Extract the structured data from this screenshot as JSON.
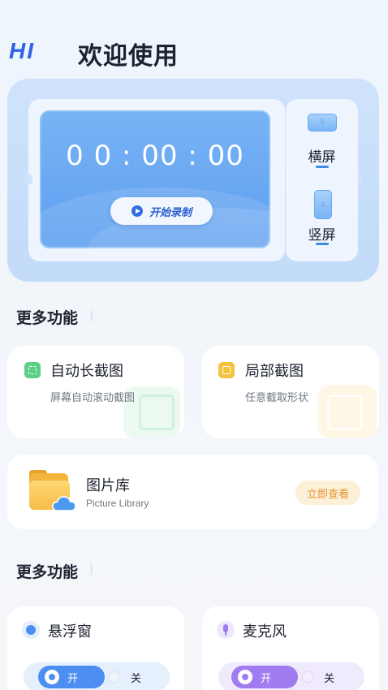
{
  "header": {
    "greeting": "HI",
    "welcome": "欢迎使用"
  },
  "recorder": {
    "timer": "0 0 : 00 :  00",
    "start_label": "开始录制",
    "landscape_label": "横屏",
    "portrait_label": "竖屏"
  },
  "section1": {
    "title": "更多功能"
  },
  "features": [
    {
      "title": "自动长截图",
      "subtitle": "屏幕自动滚动截图",
      "icon": "long-screenshot-icon",
      "color": "#5ccf86"
    },
    {
      "title": "局部截图",
      "subtitle": "任意截取形状",
      "icon": "crop-screenshot-icon",
      "color": "#f4c23c"
    }
  ],
  "gallery": {
    "title": "图片库",
    "subtitle": "Picture Library",
    "button": "立即查看",
    "icon": "folder-cloud-icon"
  },
  "section2": {
    "title": "更多功能"
  },
  "toggles": [
    {
      "title": "悬浮窗",
      "on_label": "开",
      "off_label": "关",
      "state": "on",
      "color": "#4d8ff0",
      "icon": "floating-window-icon"
    },
    {
      "title": "麦克风",
      "on_label": "开",
      "off_label": "关",
      "state": "on",
      "color": "#a07cf0",
      "icon": "microphone-icon"
    }
  ],
  "colors": {
    "accent_blue": "#2f63e6",
    "screen_blue": "#6aa8f2",
    "orange": "#e4922a"
  }
}
